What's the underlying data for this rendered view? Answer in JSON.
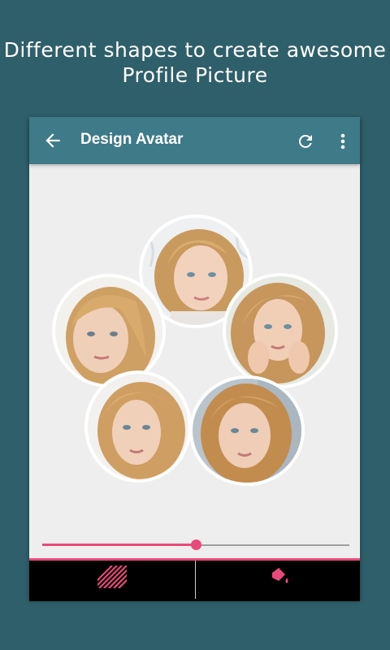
{
  "promo": {
    "line1": "Different shapes to create awesome",
    "line2": "Profile Picture"
  },
  "appbar": {
    "title": "Design Avatar",
    "icons": [
      "back-arrow-icon",
      "refresh-icon",
      "more-vert-icon"
    ]
  },
  "colors": {
    "background": "#2f5f6a",
    "appbar": "#3e7a88",
    "accent": "#e8497a",
    "bottombar": "#000000"
  },
  "slider": {
    "value_percent": 50
  },
  "bottom_tabs": [
    {
      "icon": "pattern-icon"
    },
    {
      "icon": "paint-bucket-icon"
    }
  ]
}
